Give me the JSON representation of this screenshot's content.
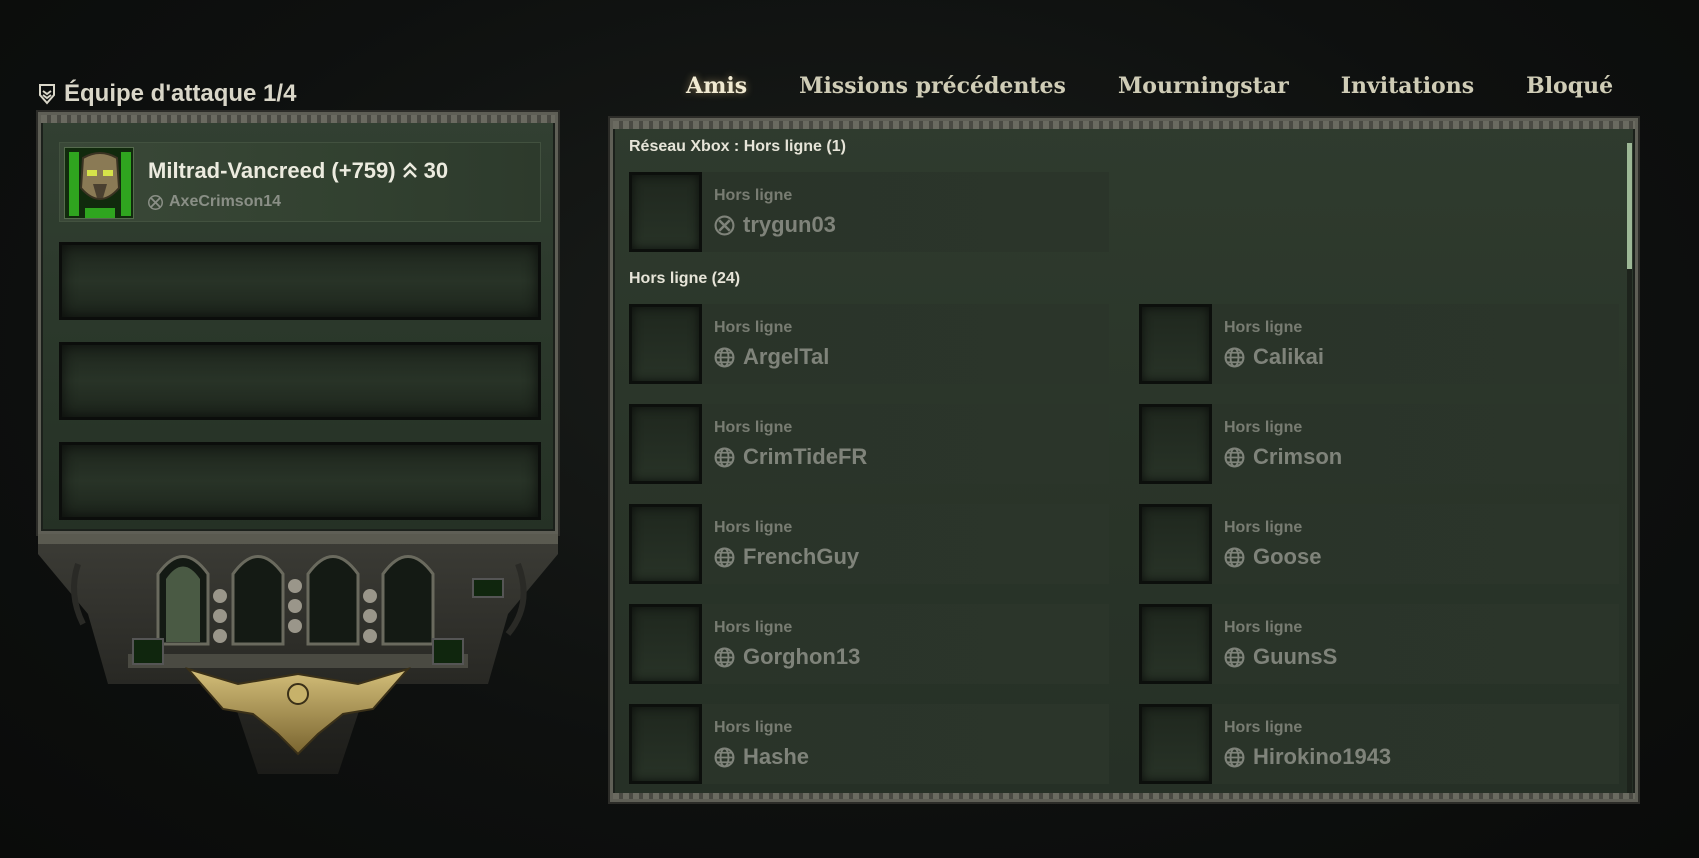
{
  "team": {
    "title": "Équipe d'attaque 1/4",
    "player": {
      "name": "Miltrad-Vancreed (+759)",
      "level": "30",
      "account": "AxeCrimson14"
    }
  },
  "tabs": [
    {
      "label": "Amis",
      "active": true
    },
    {
      "label": "Missions précédentes",
      "active": false
    },
    {
      "label": "Mourningstar",
      "active": false
    },
    {
      "label": "Invitations",
      "active": false
    },
    {
      "label": "Bloqué",
      "active": false
    }
  ],
  "friends": {
    "xbox_section": {
      "header": "Réseau Xbox : Hors ligne (1)",
      "items": [
        {
          "status": "Hors ligne",
          "name": "trygun03",
          "platform_icon": "xbox-icon"
        }
      ]
    },
    "offline_section": {
      "header": "Hors ligne (24)",
      "items": [
        {
          "status": "Hors ligne",
          "name": "ArgelTal",
          "platform_icon": "globe-icon"
        },
        {
          "status": "Hors ligne",
          "name": "Calikai",
          "platform_icon": "globe-icon"
        },
        {
          "status": "Hors ligne",
          "name": "CrimTideFR",
          "platform_icon": "globe-icon"
        },
        {
          "status": "Hors ligne",
          "name": "Crimson",
          "platform_icon": "globe-icon"
        },
        {
          "status": "Hors ligne",
          "name": "FrenchGuy",
          "platform_icon": "globe-icon"
        },
        {
          "status": "Hors ligne",
          "name": "Goose",
          "platform_icon": "globe-icon"
        },
        {
          "status": "Hors ligne",
          "name": "Gorghon13",
          "platform_icon": "globe-icon"
        },
        {
          "status": "Hors ligne",
          "name": "GuunsS",
          "platform_icon": "globe-icon"
        },
        {
          "status": "Hors ligne",
          "name": "Hashe",
          "platform_icon": "globe-icon"
        },
        {
          "status": "Hors ligne",
          "name": "Hirokino1943",
          "platform_icon": "globe-icon"
        }
      ]
    }
  },
  "colors": {
    "panel_green": "#2f3b2e",
    "frame_steel": "#5f5f56",
    "scroll_thumb": "#9db896",
    "title_text": "#d9d6c8"
  }
}
